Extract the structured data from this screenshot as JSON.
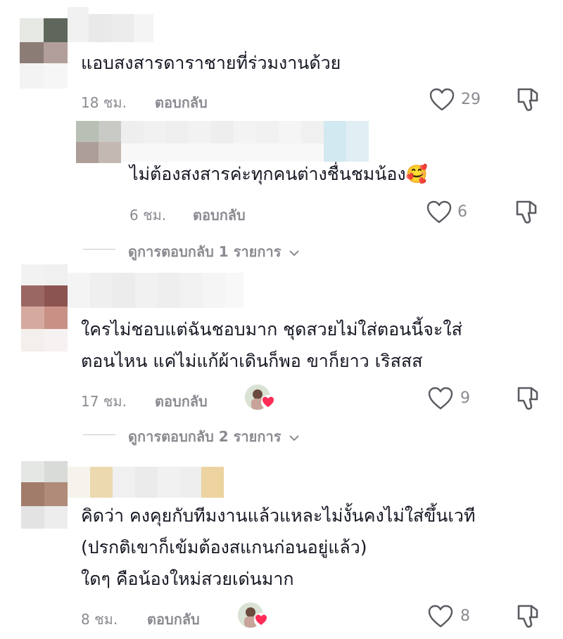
{
  "comments": [
    {
      "text_lines": [
        "แอบสงสารดาราชายที่ร่วมงานด้วย"
      ],
      "time": "18 ชม.",
      "reply_label": "ตอบกลับ",
      "likes": "29"
    },
    {
      "text_lines": [
        "ไม่ต้องสงสารค่ะทุกคนต่างชื่นชมน้อง🥰"
      ],
      "time": "6 ชม.",
      "reply_label": "ตอบกลับ",
      "likes": "6",
      "view_replies": "ดูการตอบกลับ 1 รายการ"
    },
    {
      "text_lines": [
        "ใครไม่ชอบแต่ฉันชอบมาก ชุดสวยไม่ใส่ตอนนี้จะใส่",
        "ตอนไหน แค่ไม่แก้ผ้าเดินก็พอ ขาก็ยาว เริสสส"
      ],
      "time": "17 ชม.",
      "reply_label": "ตอบกลับ",
      "likes": "9",
      "view_replies": "ดูการตอบกลับ 2 รายการ"
    },
    {
      "text_lines": [
        "คิดว่า คงคุยกับทีมงานแล้วแหละไม่งั้นคงไม่ใส่ขึ้นเวที",
        "(ปรกติเขาก็เข้มต้องสแกนก่อนอยู่แล้ว)",
        "ใดๆ คือน้องใหม่สวยเด่นมาก"
      ],
      "time": "8 ชม.",
      "reply_label": "ตอบกลับ",
      "likes": "8"
    }
  ],
  "icons": {
    "like": "heart-outline-icon",
    "dislike": "thumb-down-icon",
    "expand": "chevron-down-icon"
  },
  "colors": {
    "text": "#161823",
    "muted": "#8a8b91",
    "heart_badge": "#fe2c55"
  }
}
